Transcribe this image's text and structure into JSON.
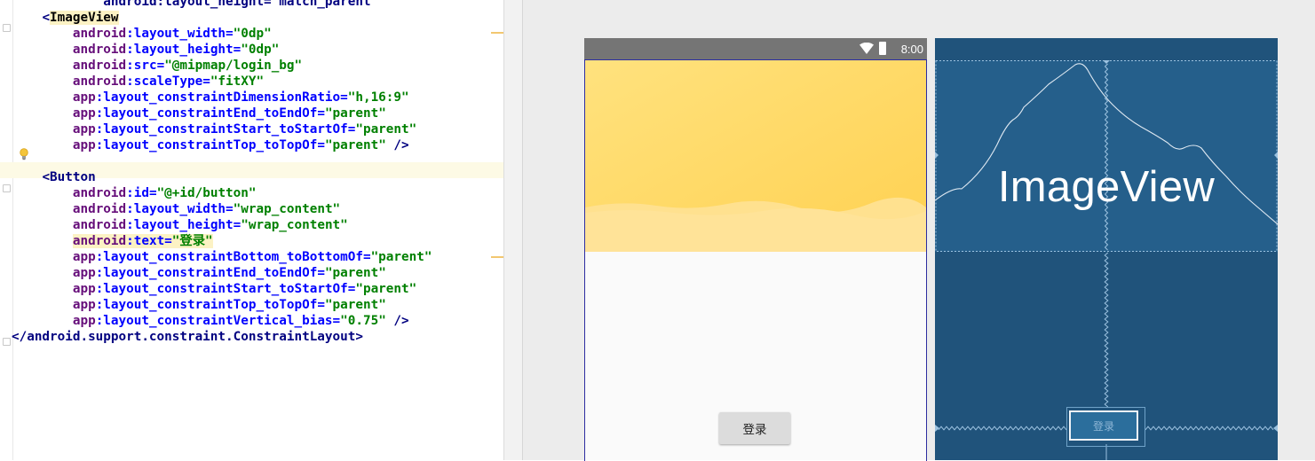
{
  "code_lines": [
    [
      [
        "plain",
        "            "
      ],
      [
        "tag",
        "android:layout_height=\"match_parent\""
      ]
    ],
    [
      [
        "plain",
        "    "
      ],
      [
        "tag",
        "<"
      ],
      [
        "tagname-hl",
        "ImageView"
      ]
    ],
    [
      [
        "plain",
        "        "
      ],
      [
        "ns",
        "android"
      ],
      [
        "attr",
        ":layout_width="
      ],
      [
        "val",
        "\"0dp\""
      ]
    ],
    [
      [
        "plain",
        "        "
      ],
      [
        "ns",
        "android"
      ],
      [
        "attr",
        ":layout_height="
      ],
      [
        "val",
        "\"0dp\""
      ]
    ],
    [
      [
        "plain",
        "        "
      ],
      [
        "ns",
        "android"
      ],
      [
        "attr",
        ":src="
      ],
      [
        "val",
        "\"@mipmap/login_bg\""
      ]
    ],
    [
      [
        "plain",
        "        "
      ],
      [
        "ns",
        "android"
      ],
      [
        "attr",
        ":scaleType="
      ],
      [
        "val",
        "\"fitXY\""
      ]
    ],
    [
      [
        "plain",
        "        "
      ],
      [
        "ns",
        "app"
      ],
      [
        "attr",
        ":layout_constraintDimensionRatio="
      ],
      [
        "val",
        "\"h,16:9\""
      ]
    ],
    [
      [
        "plain",
        "        "
      ],
      [
        "ns",
        "app"
      ],
      [
        "attr",
        ":layout_constraintEnd_toEndOf="
      ],
      [
        "val",
        "\"parent\""
      ]
    ],
    [
      [
        "plain",
        "        "
      ],
      [
        "ns",
        "app"
      ],
      [
        "attr",
        ":layout_constraintStart_toStartOf="
      ],
      [
        "val",
        "\"parent\""
      ]
    ],
    [
      [
        "plain",
        "        "
      ],
      [
        "ns",
        "app"
      ],
      [
        "attr",
        ":layout_constraintTop_toTopOf="
      ],
      [
        "val",
        "\"parent\""
      ],
      [
        "tag",
        " />"
      ]
    ],
    [
      [
        "plain",
        ""
      ]
    ],
    [
      [
        "plain",
        "    "
      ],
      [
        "tag",
        "<Button"
      ]
    ],
    [
      [
        "plain",
        "        "
      ],
      [
        "ns",
        "android"
      ],
      [
        "attr",
        ":id="
      ],
      [
        "val",
        "\"@+id/button\""
      ]
    ],
    [
      [
        "plain",
        "        "
      ],
      [
        "ns",
        "android"
      ],
      [
        "attr",
        ":layout_width="
      ],
      [
        "val",
        "\"wrap_content\""
      ]
    ],
    [
      [
        "plain",
        "        "
      ],
      [
        "ns",
        "android"
      ],
      [
        "attr",
        ":layout_height="
      ],
      [
        "val",
        "\"wrap_content\""
      ]
    ],
    [
      [
        "plain",
        "        "
      ],
      [
        "ns-hl",
        "android"
      ],
      [
        "attr-hl",
        ":text="
      ],
      [
        "val-hl",
        "\"登录\""
      ]
    ],
    [
      [
        "plain",
        "        "
      ],
      [
        "ns",
        "app"
      ],
      [
        "attr",
        ":layout_constraintBottom_toBottomOf="
      ],
      [
        "val",
        "\"parent\""
      ]
    ],
    [
      [
        "plain",
        "        "
      ],
      [
        "ns",
        "app"
      ],
      [
        "attr",
        ":layout_constraintEnd_toEndOf="
      ],
      [
        "val",
        "\"parent\""
      ]
    ],
    [
      [
        "plain",
        "        "
      ],
      [
        "ns",
        "app"
      ],
      [
        "attr",
        ":layout_constraintStart_toStartOf="
      ],
      [
        "val",
        "\"parent\""
      ]
    ],
    [
      [
        "plain",
        "        "
      ],
      [
        "ns",
        "app"
      ],
      [
        "attr",
        ":layout_constraintTop_toTopOf="
      ],
      [
        "val",
        "\"parent\""
      ]
    ],
    [
      [
        "plain",
        "        "
      ],
      [
        "ns",
        "app"
      ],
      [
        "attr",
        ":layout_constraintVertical_bias="
      ],
      [
        "val",
        "\"0.75\""
      ],
      [
        "tag",
        " />"
      ]
    ],
    [
      [
        "tag",
        "</android.support.constraint.ConstraintLayout>"
      ]
    ]
  ],
  "preview": {
    "status_time": "8:00",
    "button_text": "登录"
  },
  "blueprint": {
    "image_label": "ImageView",
    "button_text": "登录"
  },
  "icons": {
    "wifi": "wifi-icon",
    "battery": "battery-icon",
    "bulb": "intention-bulb-icon",
    "fold": "fold-marker-icon"
  },
  "colors": {
    "blueprint_bg": "#20537b",
    "accent_wave": "#ffd86a"
  }
}
